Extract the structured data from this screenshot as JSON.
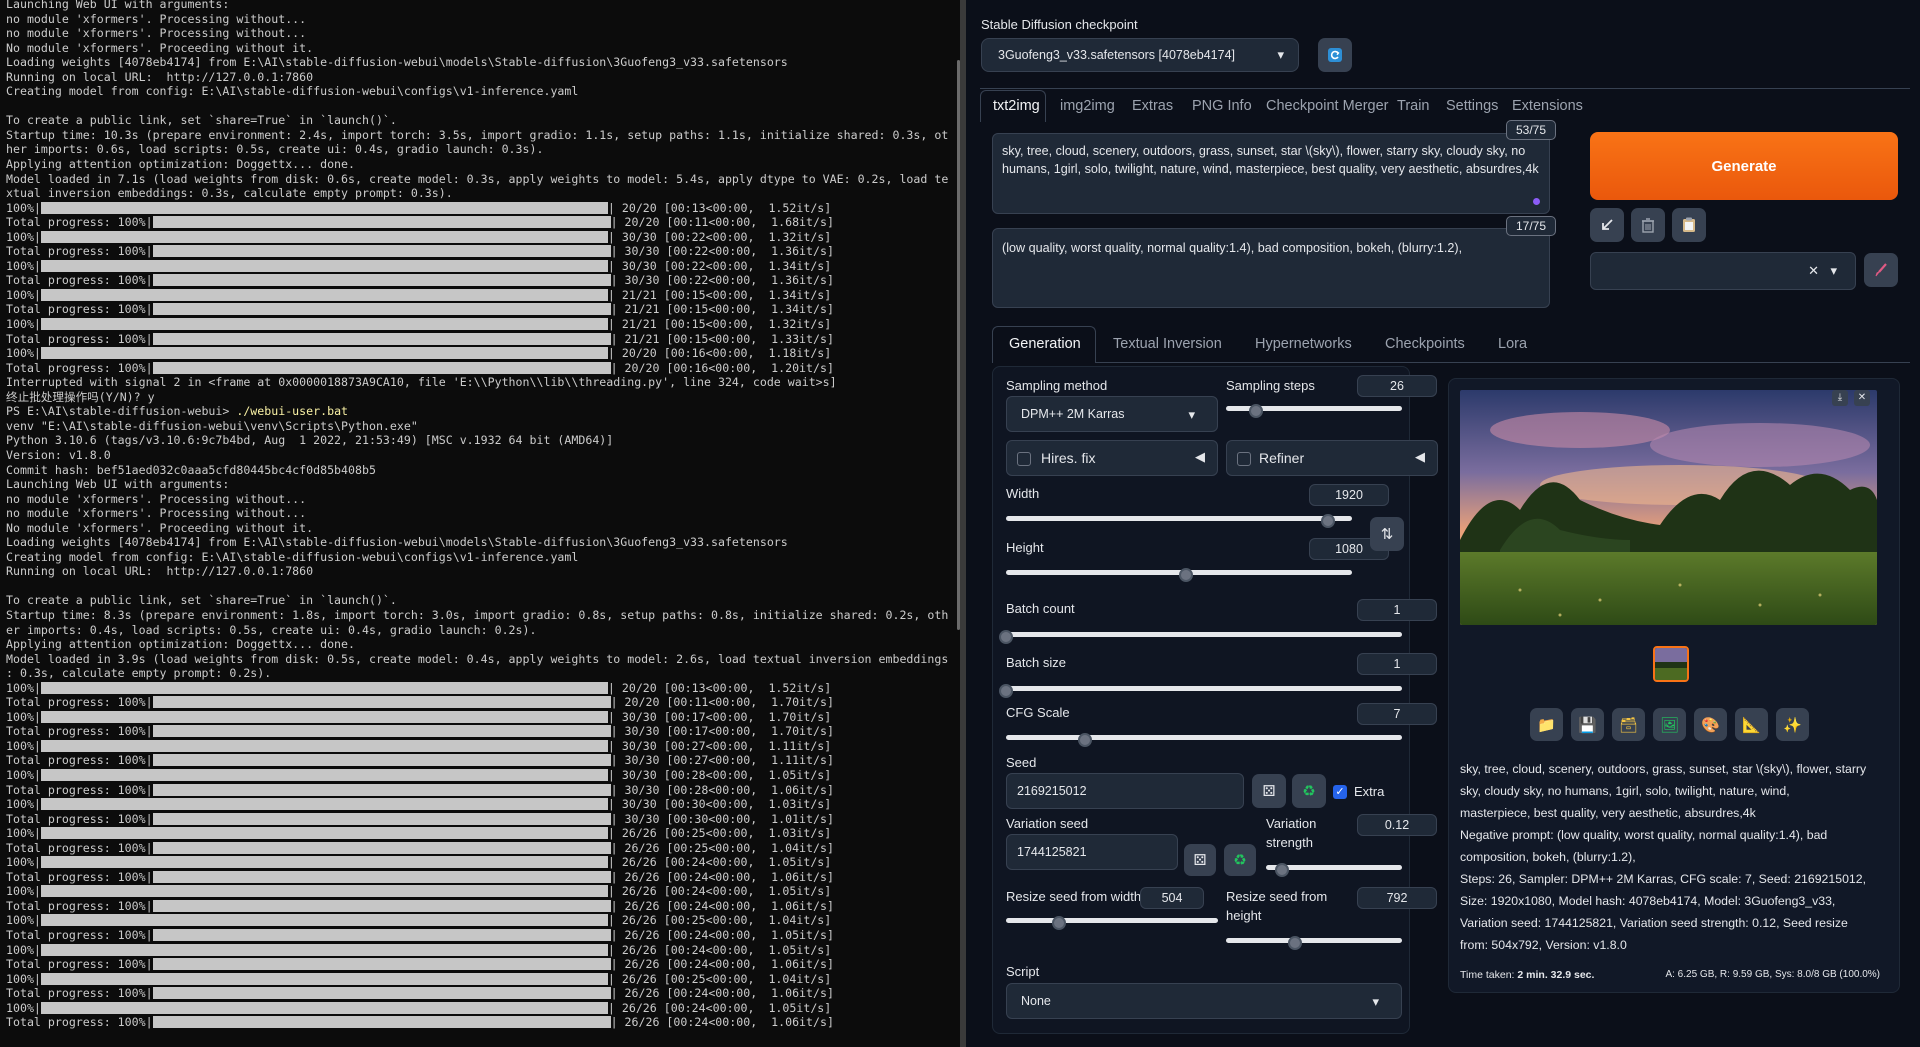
{
  "terminal": {
    "lines": [
      {
        "t": "Launching Web UI with arguments:"
      },
      {
        "t": "no module 'xformers'. Processing without..."
      },
      {
        "t": "no module 'xformers'. Processing without..."
      },
      {
        "t": "No module 'xformers'. Proceeding without it."
      },
      {
        "t": "Loading weights [4078eb4174] from E:\\AI\\stable-diffusion-webui\\models\\Stable-diffusion\\3Guofeng3_v33.safetensors"
      },
      {
        "t": "Running on local URL:  http://127.0.0.1:7860"
      },
      {
        "t": "Creating model from config: E:\\AI\\stable-diffusion-webui\\configs\\v1-inference.yaml"
      },
      {
        "t": ""
      },
      {
        "t": "To create a public link, set `share=True` in `launch()`."
      },
      {
        "t": "Startup time: 10.3s (prepare environment: 2.4s, import torch: 3.5s, import gradio: 1.1s, setup paths: 1.1s, initialize shared: 0.3s, ot"
      },
      {
        "t": "her imports: 0.6s, load scripts: 0.5s, create ui: 0.4s, gradio launch: 0.3s)."
      },
      {
        "t": "Applying attention optimization: Doggettx... done."
      },
      {
        "t": "Model loaded in 7.1s (load weights from disk: 0.6s, create model: 0.3s, apply weights to model: 5.4s, apply dtype to VAE: 0.2s, load te"
      },
      {
        "t": "xtual inversion embeddings: 0.3s, calculate empty prompt: 0.3s)."
      },
      {
        "p": "100%|",
        "s": "| 20/20 [00:13<00:00,  1.52it/s]"
      },
      {
        "p": "Total progress: 100%|",
        "s": "| 20/20 [00:11<00:00,  1.68it/s]",
        "short": true
      },
      {
        "p": "100%|",
        "s": "| 30/30 [00:22<00:00,  1.32it/s]"
      },
      {
        "p": "Total progress: 100%|",
        "s": "| 30/30 [00:22<00:00,  1.36it/s]",
        "short": true
      },
      {
        "p": "100%|",
        "s": "| 30/30 [00:22<00:00,  1.34it/s]"
      },
      {
        "p": "Total progress: 100%|",
        "s": "| 30/30 [00:22<00:00,  1.36it/s]",
        "short": true
      },
      {
        "p": "100%|",
        "s": "| 21/21 [00:15<00:00,  1.34it/s]"
      },
      {
        "p": "Total progress: 100%|",
        "s": "| 21/21 [00:15<00:00,  1.34it/s]",
        "short": true
      },
      {
        "p": "100%|",
        "s": "| 21/21 [00:15<00:00,  1.32it/s]"
      },
      {
        "p": "Total progress: 100%|",
        "s": "| 21/21 [00:15<00:00,  1.33it/s]",
        "short": true
      },
      {
        "p": "100%|",
        "s": "| 20/20 [00:16<00:00,  1.18it/s]"
      },
      {
        "p": "Total progress: 100%|",
        "s": "| 20/20 [00:16<00:00,  1.20it/s]",
        "short": true
      },
      {
        "t": "Interrupted with signal 2 in <frame at 0x0000018873A9CA10, file 'E:\\\\Python\\\\lib\\\\threading.py', line 324, code wait>s]"
      },
      {
        "t": "终止批处理操作吗(Y/N)? y"
      },
      {
        "t": "PS E:\\AI\\stable-diffusion-webui> ",
        "y": "./webui-user.bat"
      },
      {
        "t": "venv \"E:\\AI\\stable-diffusion-webui\\venv\\Scripts\\Python.exe\""
      },
      {
        "t": "Python 3.10.6 (tags/v3.10.6:9c7b4bd, Aug  1 2022, 21:53:49) [MSC v.1932 64 bit (AMD64)]"
      },
      {
        "t": "Version: v1.8.0"
      },
      {
        "t": "Commit hash: bef51aed032c0aaa5cfd80445bc4cf0d85b408b5"
      },
      {
        "t": "Launching Web UI with arguments:"
      },
      {
        "t": "no module 'xformers'. Processing without..."
      },
      {
        "t": "no module 'xformers'. Processing without..."
      },
      {
        "t": "No module 'xformers'. Proceeding without it."
      },
      {
        "t": "Loading weights [4078eb4174] from E:\\AI\\stable-diffusion-webui\\models\\Stable-diffusion\\3Guofeng3_v33.safetensors"
      },
      {
        "t": "Creating model from config: E:\\AI\\stable-diffusion-webui\\configs\\v1-inference.yaml"
      },
      {
        "t": "Running on local URL:  http://127.0.0.1:7860"
      },
      {
        "t": ""
      },
      {
        "t": "To create a public link, set `share=True` in `launch()`."
      },
      {
        "t": "Startup time: 8.3s (prepare environment: 1.8s, import torch: 3.0s, import gradio: 0.8s, setup paths: 0.8s, initialize shared: 0.2s, oth"
      },
      {
        "t": "er imports: 0.4s, load scripts: 0.5s, create ui: 0.4s, gradio launch: 0.2s)."
      },
      {
        "t": "Applying attention optimization: Doggettx... done."
      },
      {
        "t": "Model loaded in 3.9s (load weights from disk: 0.5s, create model: 0.4s, apply weights to model: 2.6s, load textual inversion embeddings"
      },
      {
        "t": ": 0.3s, calculate empty prompt: 0.2s)."
      },
      {
        "p": "100%|",
        "s": "| 20/20 [00:13<00:00,  1.52it/s]"
      },
      {
        "p": "Total progress: 100%|",
        "s": "| 20/20 [00:11<00:00,  1.70it/s]",
        "short": true
      },
      {
        "p": "100%|",
        "s": "| 30/30 [00:17<00:00,  1.70it/s]"
      },
      {
        "p": "Total progress: 100%|",
        "s": "| 30/30 [00:17<00:00,  1.70it/s]",
        "short": true
      },
      {
        "p": "100%|",
        "s": "| 30/30 [00:27<00:00,  1.11it/s]"
      },
      {
        "p": "Total progress: 100%|",
        "s": "| 30/30 [00:27<00:00,  1.11it/s]",
        "short": true
      },
      {
        "p": "100%|",
        "s": "| 30/30 [00:28<00:00,  1.05it/s]"
      },
      {
        "p": "Total progress: 100%|",
        "s": "| 30/30 [00:28<00:00,  1.06it/s]",
        "short": true
      },
      {
        "p": "100%|",
        "s": "| 30/30 [00:30<00:00,  1.03it/s]"
      },
      {
        "p": "Total progress: 100%|",
        "s": "| 30/30 [00:30<00:00,  1.01it/s]",
        "short": true
      },
      {
        "p": "100%|",
        "s": "| 26/26 [00:25<00:00,  1.03it/s]"
      },
      {
        "p": "Total progress: 100%|",
        "s": "| 26/26 [00:25<00:00,  1.04it/s]",
        "short": true
      },
      {
        "p": "100%|",
        "s": "| 26/26 [00:24<00:00,  1.05it/s]"
      },
      {
        "p": "Total progress: 100%|",
        "s": "| 26/26 [00:24<00:00,  1.06it/s]",
        "short": true
      },
      {
        "p": "100%|",
        "s": "| 26/26 [00:24<00:00,  1.05it/s]"
      },
      {
        "p": "Total progress: 100%|",
        "s": "| 26/26 [00:24<00:00,  1.06it/s]",
        "short": true
      },
      {
        "p": "100%|",
        "s": "| 26/26 [00:25<00:00,  1.04it/s]"
      },
      {
        "p": "Total progress: 100%|",
        "s": "| 26/26 [00:24<00:00,  1.05it/s]",
        "short": true
      },
      {
        "p": "100%|",
        "s": "| 26/26 [00:24<00:00,  1.05it/s]"
      },
      {
        "p": "Total progress: 100%|",
        "s": "| 26/26 [00:24<00:00,  1.06it/s]",
        "short": true
      },
      {
        "p": "100%|",
        "s": "| 26/26 [00:25<00:00,  1.04it/s]"
      },
      {
        "p": "Total progress: 100%|",
        "s": "| 26/26 [00:24<00:00,  1.06it/s]",
        "short": true
      },
      {
        "p": "100%|",
        "s": "| 26/26 [00:24<00:00,  1.05it/s]"
      },
      {
        "p": "Total progress: 100%|",
        "s": "| 26/26 [00:24<00:00,  1.06it/s]",
        "short": true
      }
    ]
  },
  "webui": {
    "checkpoint_label": "Stable Diffusion checkpoint",
    "checkpoint_value": "3Guofeng3_v33.safetensors [4078eb4174]",
    "tabs": [
      "txt2img",
      "img2img",
      "Extras",
      "PNG Info",
      "Checkpoint Merger",
      "Train",
      "Settings",
      "Extensions"
    ],
    "prompt": {
      "token_count": "53/75",
      "text_line1": "sky, tree, cloud, scenery, outdoors, grass, sunset, star \\(sky\\), flower, starry sky, cloudy sky, no",
      "text_line2": "humans, 1girl, solo, twilight, nature, wind, masterpiece, best quality, very aesthetic, absurdres,4k"
    },
    "negative_prompt": {
      "token_count": "17/75",
      "text": "(low quality, worst quality, normal quality:1.4), bad composition, bokeh, (blurry:1.2),"
    },
    "generate_label": "Generate",
    "subtabs": [
      "Generation",
      "Textual Inversion",
      "Hypernetworks",
      "Checkpoints",
      "Lora"
    ],
    "sampling_method_label": "Sampling method",
    "sampling_method_value": "DPM++ 2M Karras",
    "sampling_steps_label": "Sampling steps",
    "sampling_steps_value": "26",
    "sampling_steps_fraction": 0.17,
    "hires_label": "Hires. fix",
    "refiner_label": "Refiner",
    "width_label": "Width",
    "width_value": "1920",
    "width_fraction": 0.93,
    "height_label": "Height",
    "height_value": "1080",
    "height_fraction": 0.52,
    "batch_count_label": "Batch count",
    "batch_count_value": "1",
    "batch_count_fraction": 0.0,
    "batch_size_label": "Batch size",
    "batch_size_value": "1",
    "batch_size_fraction": 0.0,
    "cfg_label": "CFG Scale",
    "cfg_value": "7",
    "cfg_fraction": 0.2,
    "seed_label": "Seed",
    "seed_value": "2169215012",
    "extra_label": "Extra",
    "variation_seed_label": "Variation seed",
    "variation_seed_value": "1744125821",
    "variation_strength_label_1": "Variation",
    "variation_strength_label_2": "strength",
    "variation_strength_value": "0.12",
    "variation_strength_fraction": 0.12,
    "resize_w_label": "Resize seed from width",
    "resize_w_value": "504",
    "resize_w_fraction": 0.25,
    "resize_h_label_1": "Resize seed from",
    "resize_h_label_2": "height",
    "resize_h_value": "792",
    "resize_h_fraction": 0.39,
    "script_label": "Script",
    "script_value": "None",
    "info_lines": [
      "sky, tree, cloud, scenery, outdoors, grass, sunset, star \\(sky\\), flower, starry",
      "sky, cloudy sky, no humans, 1girl, solo, twilight, nature, wind,",
      "masterpiece, best quality, very aesthetic, absurdres,4k",
      "Negative prompt: (low quality, worst quality, normal quality:1.4), bad",
      "composition, bokeh, (blurry:1.2),",
      "Steps: 26, Sampler: DPM++ 2M Karras, CFG scale: 7, Seed: 2169215012,",
      "Size: 1920x1080, Model hash: 4078eb4174, Model: 3Guofeng3_v33,",
      "Variation seed: 1744125821, Variation seed strength: 0.12, Seed resize",
      "from: 504x792, Version: v1.8.0"
    ],
    "time_taken_label": "Time taken: ",
    "time_taken_value": "2 min. 32.9 sec.",
    "vram_a": "A: 6.25 GB, R: 9.59 GB, Sys: 8.0/8 GB (100.0%)",
    "colors": {
      "accent": "#f97316",
      "background": "#0b0f19",
      "panel": "#1f2937",
      "blue_check": "#2563eb"
    }
  }
}
